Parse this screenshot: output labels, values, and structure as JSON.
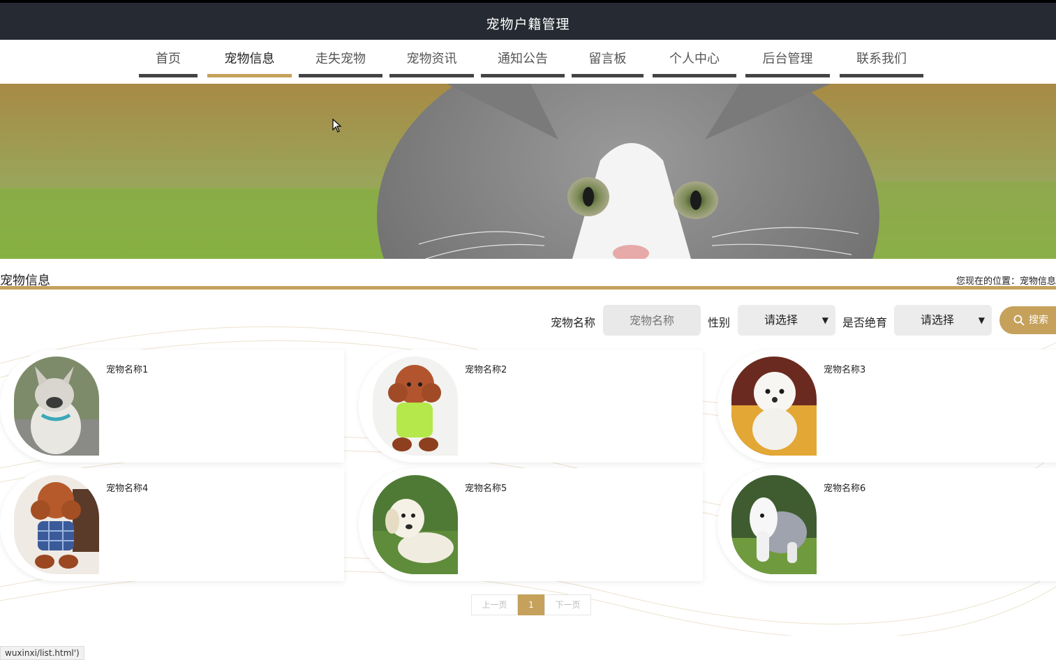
{
  "header": {
    "title": "宠物户籍管理"
  },
  "nav": [
    {
      "label": "首页"
    },
    {
      "label": "宠物信息"
    },
    {
      "label": "走失宠物"
    },
    {
      "label": "宠物资讯"
    },
    {
      "label": "通知公告"
    },
    {
      "label": "留言板"
    },
    {
      "label": "个人中心"
    },
    {
      "label": "后台管理"
    },
    {
      "label": "联系我们"
    }
  ],
  "section": {
    "title": "宠物信息",
    "breadcrumb": "您现在的位置：宠物信息"
  },
  "filter": {
    "name_label": "宠物名称",
    "name_placeholder": "宠物名称",
    "gender_label": "性别",
    "gender_value": "请选择",
    "neuter_label": "是否绝育",
    "neuter_value": "请选择",
    "search_label": "搜索"
  },
  "pets": [
    {
      "name": "宠物名称1"
    },
    {
      "name": "宠物名称2"
    },
    {
      "name": "宠物名称3"
    },
    {
      "name": "宠物名称4"
    },
    {
      "name": "宠物名称5"
    },
    {
      "name": "宠物名称6"
    }
  ],
  "pagination": {
    "prev": "上一页",
    "current": "1",
    "next": "下一页"
  },
  "status_url": "wuxinxi/list.html')",
  "colors": {
    "accent": "#c5a15c",
    "topbar": "#262b33",
    "nav_underline": "#444444"
  }
}
